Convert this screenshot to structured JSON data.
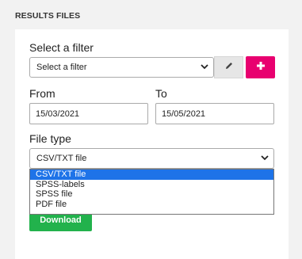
{
  "section_title": "RESULTS FILES",
  "filter": {
    "label": "Select a filter",
    "selected": "Select a filter"
  },
  "from": {
    "label": "From",
    "value": "15/03/2021"
  },
  "to": {
    "label": "To",
    "value": "15/05/2021"
  },
  "file_type": {
    "label": "File type",
    "selected": "CSV/TXT file",
    "options": [
      "CSV/TXT file",
      "SPSS-labels",
      "SPSS file",
      "PDF file"
    ]
  },
  "download_label": "Download",
  "colors": {
    "accent_pink": "#e8006f",
    "download_green": "#22b24c",
    "highlight_blue": "#1e73e8"
  },
  "icons": {
    "edit": "pencil-icon",
    "add": "plus-icon",
    "chevron": "chevron-down-icon"
  }
}
